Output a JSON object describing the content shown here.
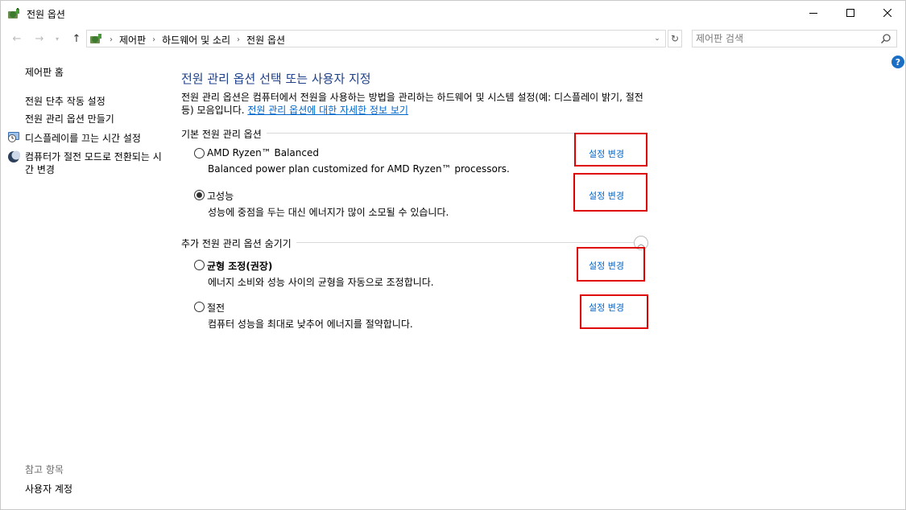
{
  "window": {
    "title": "전원 옵션"
  },
  "address_bar": {
    "crumbs": [
      "제어판",
      "하드웨어 및 소리",
      "전원 옵션"
    ]
  },
  "search": {
    "placeholder": "제어판 검색"
  },
  "help_label": "?",
  "sidebar": {
    "home": "제어판 홈",
    "items": [
      "전원 단추 작동 설정",
      "전원 관리 옵션 만들기",
      "디스플레이를 끄는 시간 설정",
      "컴퓨터가 절전 모드로 전환되는 시간 변경"
    ],
    "see_also_title": "참고 항목",
    "see_also_items": [
      "사용자 계정"
    ]
  },
  "main": {
    "title": "전원 관리 옵션 선택 또는 사용자 지정",
    "description": "전원 관리 옵션은 컴퓨터에서 전원을 사용하는 방법을 관리하는 하드웨어 및 시스템 설정(예: 디스플레이 밝기, 절전 등) 모음입니다. ",
    "more_info_link": "전원 관리 옵션에 대한 자세한 정보 보기",
    "primary_group_title": "기본 전원 관리 옵션",
    "secondary_group_title": "추가 전원 관리 옵션 숨기기",
    "change_label": "설정 변경",
    "plans": [
      {
        "name": "AMD Ryzen™ Balanced",
        "desc": "Balanced power plan customized for AMD Ryzen™ processors.",
        "selected": false
      },
      {
        "name": "고성능",
        "desc": "성능에 중점을 두는 대신 에너지가 많이 소모될 수 있습니다.",
        "selected": true
      },
      {
        "name": "균형 조정(권장)",
        "desc": "에너지 소비와 성능 사이의 균형을 자동으로 조정합니다.",
        "selected": false
      },
      {
        "name": "절전",
        "desc": "컴퓨터 성능을 최대로 낮추어 에너지를 절약합니다.",
        "selected": false
      }
    ]
  },
  "colors": {
    "heading": "#1e3f8a",
    "link": "#0066cc",
    "highlight_box": "#e00000"
  }
}
